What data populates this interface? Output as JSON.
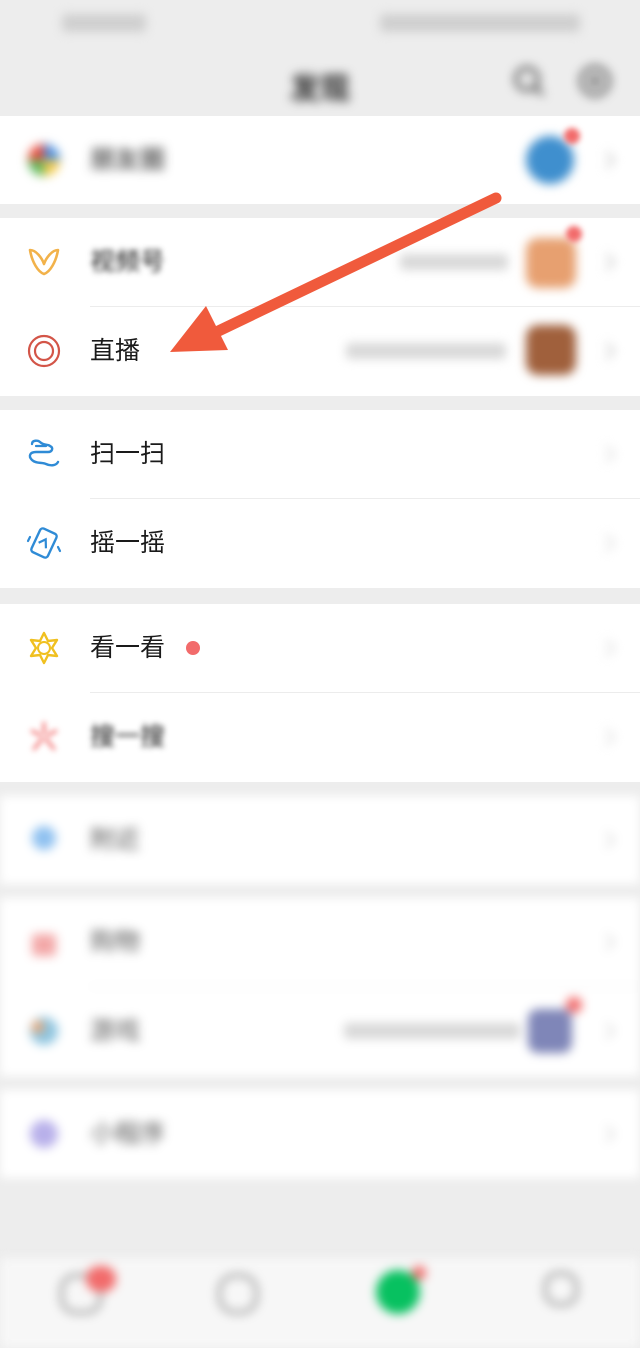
{
  "header": {
    "title": "发现"
  },
  "groups": [
    {
      "items": [
        {
          "id": "moments",
          "label": "朋友圈"
        }
      ]
    },
    {
      "items": [
        {
          "id": "channels",
          "label": "视频号",
          "sub": ""
        },
        {
          "id": "live",
          "label": "直播",
          "sub": ""
        }
      ]
    },
    {
      "items": [
        {
          "id": "scan",
          "label": "扫一扫"
        },
        {
          "id": "shake",
          "label": "摇一摇"
        }
      ]
    },
    {
      "items": [
        {
          "id": "toptories",
          "label": "看一看"
        },
        {
          "id": "search",
          "label": "搜一搜"
        }
      ]
    },
    {
      "items": [
        {
          "id": "nearby",
          "label": "附近"
        }
      ]
    },
    {
      "items": [
        {
          "id": "shopping",
          "label": "购物"
        },
        {
          "id": "games",
          "label": "游戏",
          "sub": ""
        }
      ]
    },
    {
      "items": [
        {
          "id": "miniprograms",
          "label": "小程序"
        }
      ]
    }
  ],
  "colors": {
    "arrow": "#f05a3c",
    "channels": "#f2b24a",
    "live": "#d35548",
    "scan": "#2f8bd6",
    "shake": "#2f8bd6",
    "toptories": "#f0c020",
    "search": "#f05a5a",
    "badge": "#f26b6b",
    "wechat_green": "#07c160"
  }
}
